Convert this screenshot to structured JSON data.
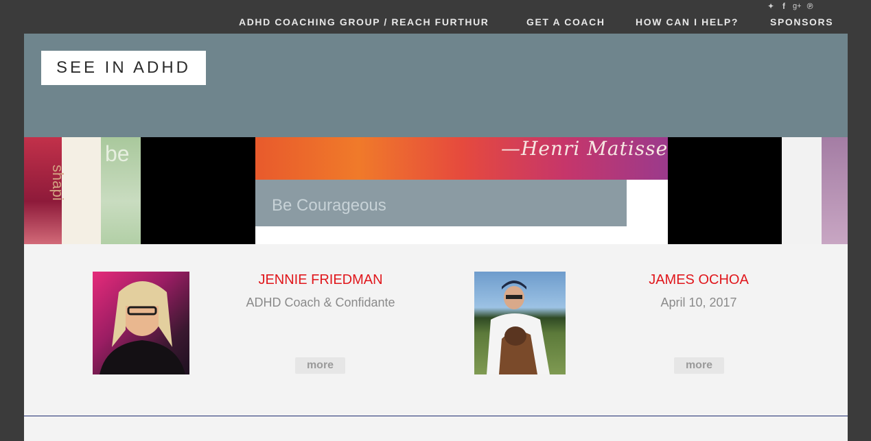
{
  "social": [
    {
      "icon": "twitter-icon",
      "glyph": "🐦"
    },
    {
      "icon": "facebook-icon",
      "glyph": "f"
    },
    {
      "icon": "google-plus-icon",
      "glyph": "g+"
    },
    {
      "icon": "pinterest-icon",
      "glyph": "P"
    }
  ],
  "nav": {
    "items": [
      "ADHD COACHING GROUP / REACH FURTHUR",
      "GET A COACH",
      "HOW CAN I HELP?",
      "SPONSORS"
    ]
  },
  "logo": "SEE IN ADHD",
  "banner": {
    "attribution": "—Henri Matisse",
    "caption": "Be Courageous",
    "word_be": "be",
    "word_vertical": "shapi"
  },
  "cards": [
    {
      "name": "JENNIE FRIEDMAN",
      "subtitle": "ADHD Coach & Confidante",
      "more": "more"
    },
    {
      "name": "JAMES OCHOA",
      "subtitle": "April 10, 2017",
      "more": "more"
    }
  ],
  "colors": {
    "background": "#3b3b3b",
    "header": "#6f858d",
    "accent_name": "#e0161b",
    "content_bg": "#f3f3f3"
  }
}
